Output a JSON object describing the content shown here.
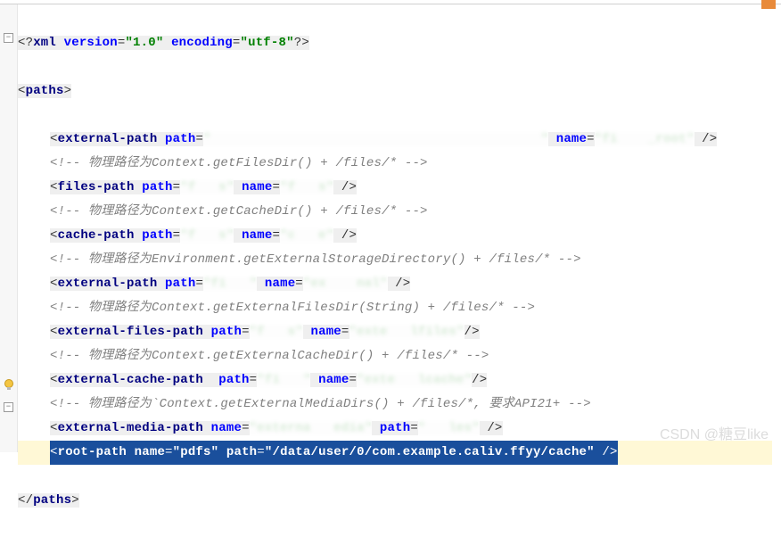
{
  "decl": {
    "open": "<?",
    "xml": "xml",
    "v_attr": "version",
    "v_val": "\"1.0\"",
    "e_attr": "encoding",
    "e_val": "\"utf-8\"",
    "close": "?>"
  },
  "paths_open": "paths",
  "lines": [
    {
      "tag": "external-path",
      "a1": "path",
      "v1": "\"                                           \"",
      "a2": "name",
      "v2": "\"fi    _root\"",
      "selfclose": " />",
      "blur1": true,
      "blur2": true
    },
    {
      "comment": "<!-- 物理路径为Context.getFilesDir() + /files/* -->"
    },
    {
      "tag": "files-path",
      "a1": "path",
      "v1": "\"f   s\"",
      "a2": "name",
      "v2": "\"f   s\"",
      "selfclose": " />",
      "blur1": true,
      "blur2": true
    },
    {
      "comment": "<!-- 物理路径为Context.getCacheDir() + /files/* -->"
    },
    {
      "tag": "cache-path",
      "a1": "path",
      "v1": "\"f   s\"",
      "a2": "name",
      "v2": "\"c   e\"",
      "selfclose": " />",
      "blur1": true,
      "blur2": true
    },
    {
      "comment": "<!-- 物理路径为Environment.getExternalStorageDirectory() + /files/* -->"
    },
    {
      "tag": "external-path",
      "a1": "path",
      "v1": "\"fi   \"",
      "a2": "name",
      "v2": "\"ex    nal\"",
      "selfclose": " />",
      "blur1": true,
      "blur2": true
    },
    {
      "comment": "<!-- 物理路径为Context.getExternalFilesDir(String) + /files/* -->"
    },
    {
      "tag": "external-files-path",
      "a1": "path",
      "v1": "\"f   s\"",
      "a2": "name",
      "v2": "\"exte   lfiles\"",
      "selfclose": "/>",
      "blur1": true,
      "blur2": true
    },
    {
      "comment": "<!-- 物理路径为Context.getExternalCacheDir() + /files/* -->"
    },
    {
      "tag": "external-cache-path",
      "a1": "path",
      "v1": "\"fi   \"",
      "a2": "name",
      "v2": "\"exte   lcache\"",
      "selfclose": "/>",
      "extra_space": "  ",
      "blur1": true,
      "blur2": true
    },
    {
      "comment": "<!-- 物理路径为`Context.getExternalMediaDirs() + /files/*, 要求API21+ -->"
    },
    {
      "tag": "external-media-path",
      "a1": "name",
      "v1": "\"externa   edia\"",
      "a2": "path",
      "v2": "\"   les\"",
      "selfclose": " />",
      "blur1": true,
      "blur2": true
    },
    {
      "selected": true,
      "tag": "root-path",
      "a1": "name",
      "v1": "\"pdfs\"",
      "a2": "path",
      "v2": "\"/data/user/0/com.example.caliv.ffyy/cache\"",
      "selfclose": " />"
    }
  ],
  "paths_close": "paths",
  "watermark": "CSDN @糖豆like"
}
